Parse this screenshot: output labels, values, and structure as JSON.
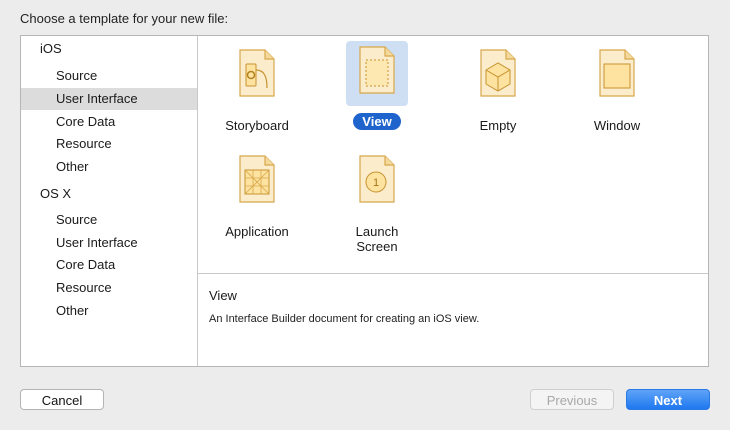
{
  "dialog": {
    "prompt": "Choose a template for your new file:"
  },
  "sidebar": {
    "sections": [
      {
        "label": "iOS",
        "items": [
          "Source",
          "User Interface",
          "Core Data",
          "Resource",
          "Other"
        ]
      },
      {
        "label": "OS X",
        "items": [
          "Source",
          "User Interface",
          "Core Data",
          "Resource",
          "Other"
        ]
      }
    ],
    "selected": "iOS / User Interface"
  },
  "templates": [
    {
      "label": "Storyboard",
      "icon": "storyboard-icon"
    },
    {
      "label": "View",
      "icon": "view-icon",
      "selected": true
    },
    {
      "label": "Empty",
      "icon": "empty-icon"
    },
    {
      "label": "Window",
      "icon": "window-icon"
    },
    {
      "label": "Application",
      "icon": "application-icon"
    },
    {
      "label": "Launch Screen",
      "icon": "launch-screen-icon"
    }
  ],
  "description": {
    "title": "View",
    "text": "An Interface Builder document for creating an iOS view."
  },
  "buttons": {
    "cancel": "Cancel",
    "previous": "Previous",
    "next": "Next"
  },
  "colors": {
    "accent": "#1f64cc",
    "selection_bg": "#cfdff3",
    "sidebar_selected": "#dcdcdc",
    "doc_fill": "#fbe2a6",
    "doc_stroke": "#d7a84c"
  }
}
